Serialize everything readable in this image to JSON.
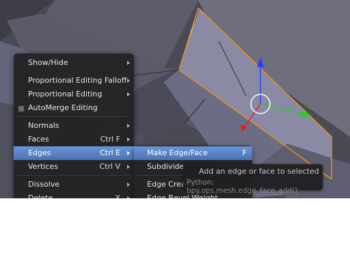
{
  "colors": {
    "viewport_bg": "#4a4a55",
    "menu_bg": "#242426",
    "highlight": "#5b86c8",
    "selection_edge": "#e8901e",
    "axis_z": "#2a3cff",
    "axis_y": "#1ed21e",
    "axis_x": "#e02020"
  },
  "menu": {
    "items": [
      {
        "label": "Show/Hide",
        "shortcut": "",
        "submenu": true
      },
      {
        "label": "Proportional Editing Falloff",
        "shortcut": "",
        "submenu": true
      },
      {
        "label": "Proportional Editing",
        "shortcut": "",
        "submenu": true
      },
      {
        "label": "AutoMerge Editing",
        "shortcut": "",
        "submenu": false,
        "checkbox": true
      },
      {
        "label": "Normals",
        "shortcut": "",
        "submenu": true
      },
      {
        "label": "Faces",
        "shortcut": "Ctrl F",
        "submenu": true
      },
      {
        "label": "Edges",
        "shortcut": "Ctrl E",
        "submenu": true,
        "active": true
      },
      {
        "label": "Vertices",
        "shortcut": "Ctrl V",
        "submenu": true
      },
      {
        "label": "Dissolve",
        "shortcut": "",
        "submenu": true
      },
      {
        "label": "Delete",
        "shortcut": "X",
        "submenu": true
      }
    ]
  },
  "edges_submenu": {
    "items": [
      {
        "label": "Make Edge/Face",
        "shortcut": "F",
        "active": true
      },
      {
        "label": "Subdivide",
        "shortcut": ""
      },
      {
        "label": "Edge Crease",
        "shortcut": ""
      },
      {
        "label": "Edge Bevel Weight",
        "shortcut": ""
      }
    ]
  },
  "tooltip": {
    "description": "Add an edge or face to selected",
    "python": "Python: bpy.ops.mesh.edge_face_add()"
  }
}
